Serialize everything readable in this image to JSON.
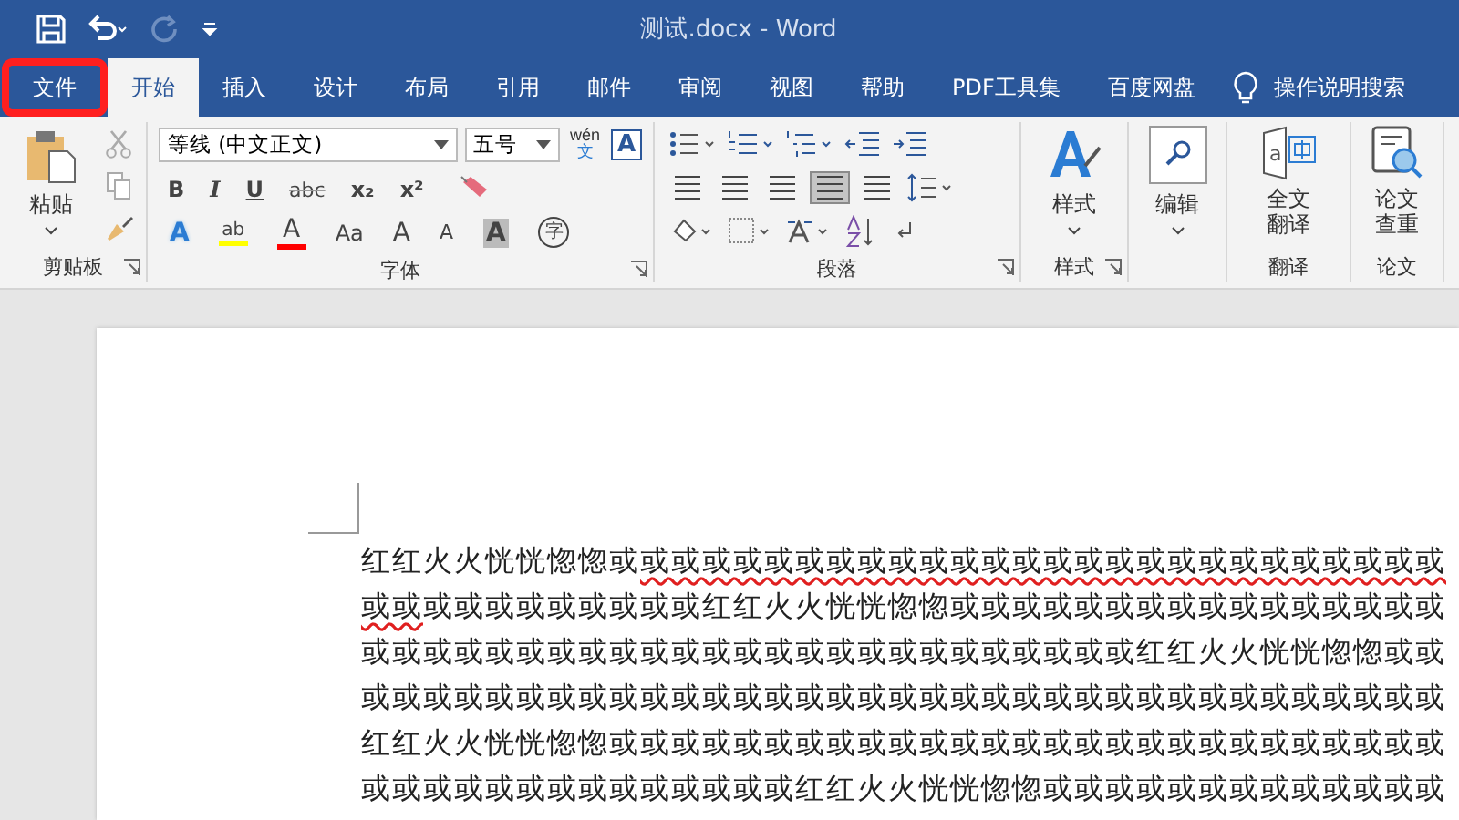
{
  "quick_access": [
    {
      "kind": "save",
      "disabled": false
    },
    {
      "kind": "undo",
      "disabled": false
    },
    {
      "kind": "redo",
      "disabled": true
    },
    {
      "kind": "customize",
      "disabled": false
    }
  ],
  "window": {
    "title": "测试.docx  -  Word"
  },
  "tabs": [
    {
      "label": "文件",
      "selected": false,
      "highlighted": true
    },
    {
      "label": "开始",
      "selected": true,
      "highlighted": false
    },
    {
      "label": "插入",
      "selected": false,
      "highlighted": false
    },
    {
      "label": "设计",
      "selected": false,
      "highlighted": false
    },
    {
      "label": "布局",
      "selected": false,
      "highlighted": false
    },
    {
      "label": "引用",
      "selected": false,
      "highlighted": false
    },
    {
      "label": "邮件",
      "selected": false,
      "highlighted": false
    },
    {
      "label": "审阅",
      "selected": false,
      "highlighted": false
    },
    {
      "label": "视图",
      "selected": false,
      "highlighted": false
    },
    {
      "label": "帮助",
      "selected": false,
      "highlighted": false
    },
    {
      "label": "PDF工具集",
      "selected": false,
      "highlighted": false
    },
    {
      "label": "百度网盘",
      "selected": false,
      "highlighted": false
    }
  ],
  "tell_me": {
    "label": "操作说明搜索"
  },
  "clipboard": {
    "label": "剪贴板",
    "paste": "粘贴"
  },
  "font": {
    "label": "字体",
    "font_name": "等线 (中文正文)",
    "font_size": "五号",
    "phonetic": "wén",
    "phonetic_char": "文",
    "border_char": "A",
    "format_buttons": [
      {
        "label": "B",
        "kind": "bold"
      },
      {
        "label": "I",
        "kind": "italic"
      },
      {
        "label": "U",
        "kind": "underline"
      },
      {
        "label": "abc",
        "kind": "strike"
      },
      {
        "label": "x₂",
        "kind": "sub"
      },
      {
        "label": "x²",
        "kind": "sup"
      }
    ],
    "effect_buttons": [
      {
        "label": "A",
        "kind": "effect"
      },
      {
        "label": "ab",
        "kind": "highlight",
        "color": "#ffff00"
      },
      {
        "label": "A",
        "kind": "color",
        "color": "#ff0000"
      },
      {
        "label": "Aa",
        "kind": "case"
      },
      {
        "label": "A",
        "kind": "grow"
      },
      {
        "label": "A",
        "kind": "shrink"
      },
      {
        "label": "A",
        "kind": "shade"
      },
      {
        "label": "字",
        "kind": "enclose"
      }
    ]
  },
  "paragraph": {
    "label": "段落",
    "align_buttons": [
      {
        "selected": false
      },
      {
        "selected": false
      },
      {
        "selected": false
      },
      {
        "selected": true
      },
      {
        "selected": false
      }
    ]
  },
  "styles": {
    "label": "样式",
    "button": "样式"
  },
  "editing": {
    "button": "编辑"
  },
  "translate": {
    "label": "翻译",
    "button": "全文翻译",
    "icon_letter": "a"
  },
  "paper": {
    "label": "论文",
    "button": "论文查重"
  },
  "document": {
    "lines": [
      [
        {
          "text": "红红火火恍恍惚惚或",
          "misspelled": false
        },
        {
          "text": "或或或或或或或或或或或或或或或或或或或或或或或或或或",
          "misspelled": true
        }
      ],
      [
        {
          "text": "或或",
          "misspelled": true
        },
        {
          "text": "或或或或或或或或或红红火火恍恍惚惚或或或或或或或或或或或或或或或或",
          "misspelled": false
        }
      ],
      [
        {
          "text": "或或或或或或或或或或或或或或或或或或或或或或或或或红红火火恍恍惚惚或或",
          "misspelled": false
        }
      ],
      [
        {
          "text": "或或或或或或或或或或或或或或或或或或或或或或或或或或或或或或或或或或或",
          "misspelled": false
        }
      ],
      [
        {
          "text": "红红火火恍恍惚惚或或或或或或或或或或或或或或或或或或或或或或或或或或或",
          "misspelled": false
        }
      ],
      [
        {
          "text": "或或或或或或或或或或或或或或红红火火恍恍惚惚或或或或或或或或或或或或或",
          "misspelled": false
        }
      ]
    ]
  }
}
